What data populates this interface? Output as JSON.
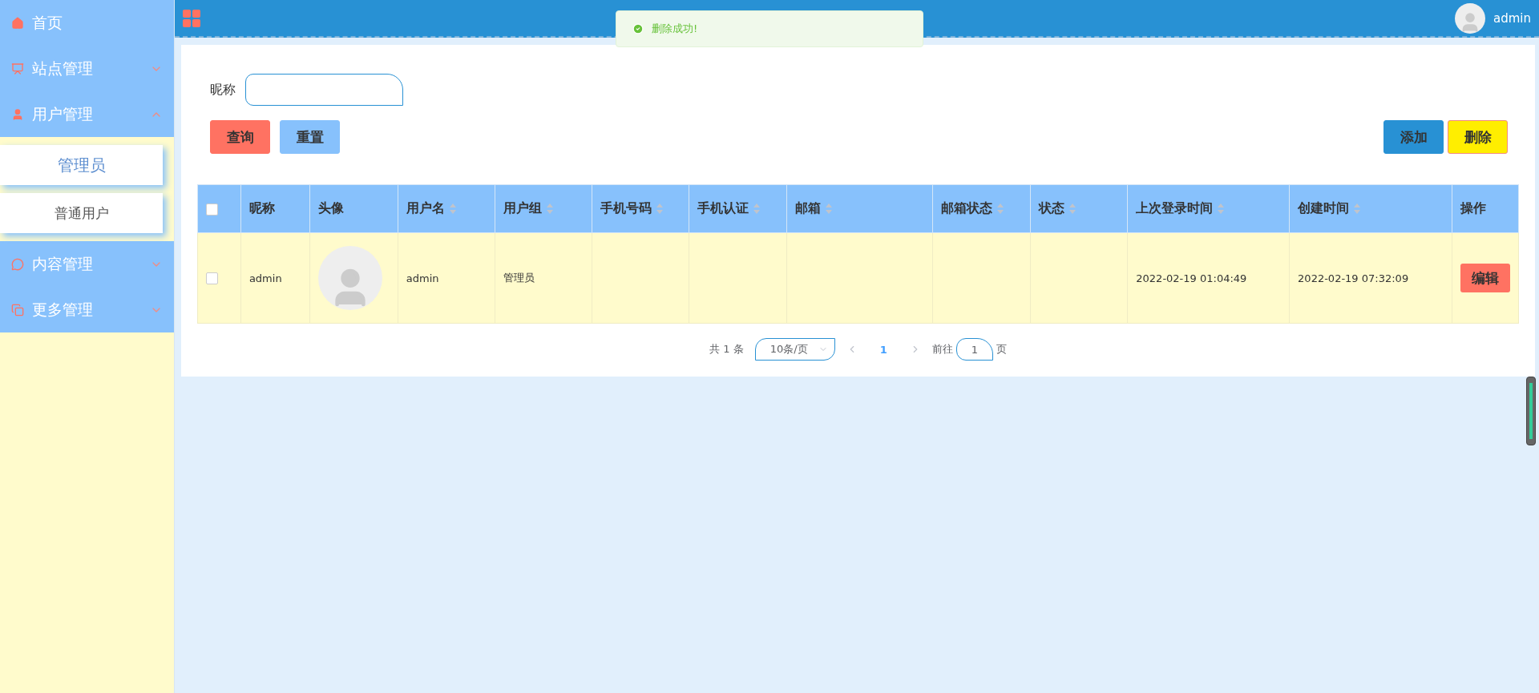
{
  "sidebar": {
    "items": [
      {
        "label": "首页"
      },
      {
        "label": "站点管理",
        "expanded": false
      },
      {
        "label": "用户管理",
        "expanded": true,
        "children": [
          {
            "label": "管理员",
            "selected": true
          },
          {
            "label": "普通用户",
            "selected": false
          }
        ]
      },
      {
        "label": "内容管理",
        "expanded": false
      },
      {
        "label": "更多管理",
        "expanded": false
      }
    ]
  },
  "header": {
    "username": "admin"
  },
  "toast": {
    "message": "删除成功!"
  },
  "search": {
    "label": "昵称"
  },
  "buttons": {
    "left": [
      "查询",
      "重置"
    ],
    "right": [
      "添加",
      "删除"
    ]
  },
  "table": {
    "select_all_checked": false,
    "columns": [
      {
        "label": "昵称",
        "sortable": false
      },
      {
        "label": "头像",
        "sortable": false
      },
      {
        "label": "用户名",
        "sortable": true
      },
      {
        "label": "用户组",
        "sortable": true
      },
      {
        "label": "手机号码",
        "sortable": true
      },
      {
        "label": "手机认证",
        "sortable": true
      },
      {
        "label": "邮箱",
        "sortable": true
      },
      {
        "label": "邮箱状态",
        "sortable": true
      },
      {
        "label": "状态",
        "sortable": true
      },
      {
        "label": "上次登录时间",
        "sortable": true
      },
      {
        "label": "创建时间",
        "sortable": true
      },
      {
        "label": "操作",
        "sortable": false
      }
    ],
    "rows": [
      {
        "checked": false,
        "cells": [
          "admin",
          "",
          "admin",
          "管理员",
          "",
          "",
          "",
          "",
          "",
          "2022-02-19 01:04:49",
          "2022-02-19 07:32:09"
        ],
        "action": "编辑"
      }
    ]
  },
  "pagination": {
    "total": "共 1 条",
    "page_size": "10条/页",
    "pages": [
      {
        "label": "1",
        "selected": true
      }
    ],
    "goto_label": "前往",
    "goto_value": "1",
    "page_suffix": "页"
  }
}
